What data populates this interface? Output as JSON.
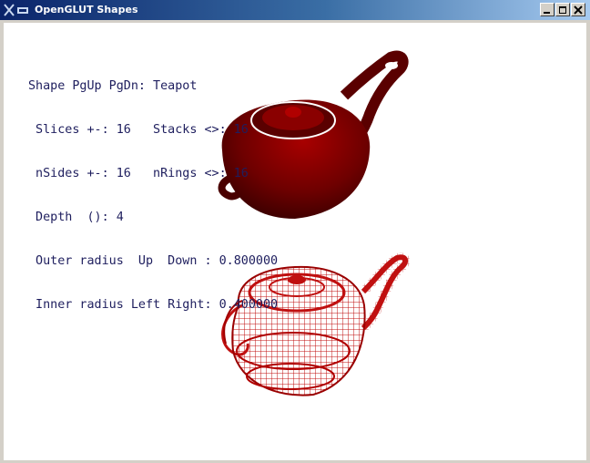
{
  "window": {
    "title": "OpenGLUT Shapes",
    "system_icon": "x-window-icon"
  },
  "titlebar_buttons": [
    {
      "name": "minimize-button",
      "icon": "minimize-icon"
    },
    {
      "name": "maximize-button",
      "icon": "maximize-icon"
    },
    {
      "name": "close-button",
      "icon": "close-icon"
    }
  ],
  "overlay": {
    "line1": "Shape PgUp PgDn: Teapot",
    "line2": " Slices +-: 16   Stacks <>: 16",
    "line3": " nSides +-: 16   nRings <>: 16",
    "line4": " Depth  (): 4",
    "line5": " Outer radius  Up  Down : 0.800000",
    "line6": " Inner radius Left Right: 0.400000"
  },
  "colors": {
    "titlebar_start": "#0a246a",
    "titlebar_end": "#a6caf0",
    "text": "#1e1e5e",
    "solid_teapot": "#6e0000",
    "wire_teapot": "#c01010",
    "background": "#ffffff"
  }
}
